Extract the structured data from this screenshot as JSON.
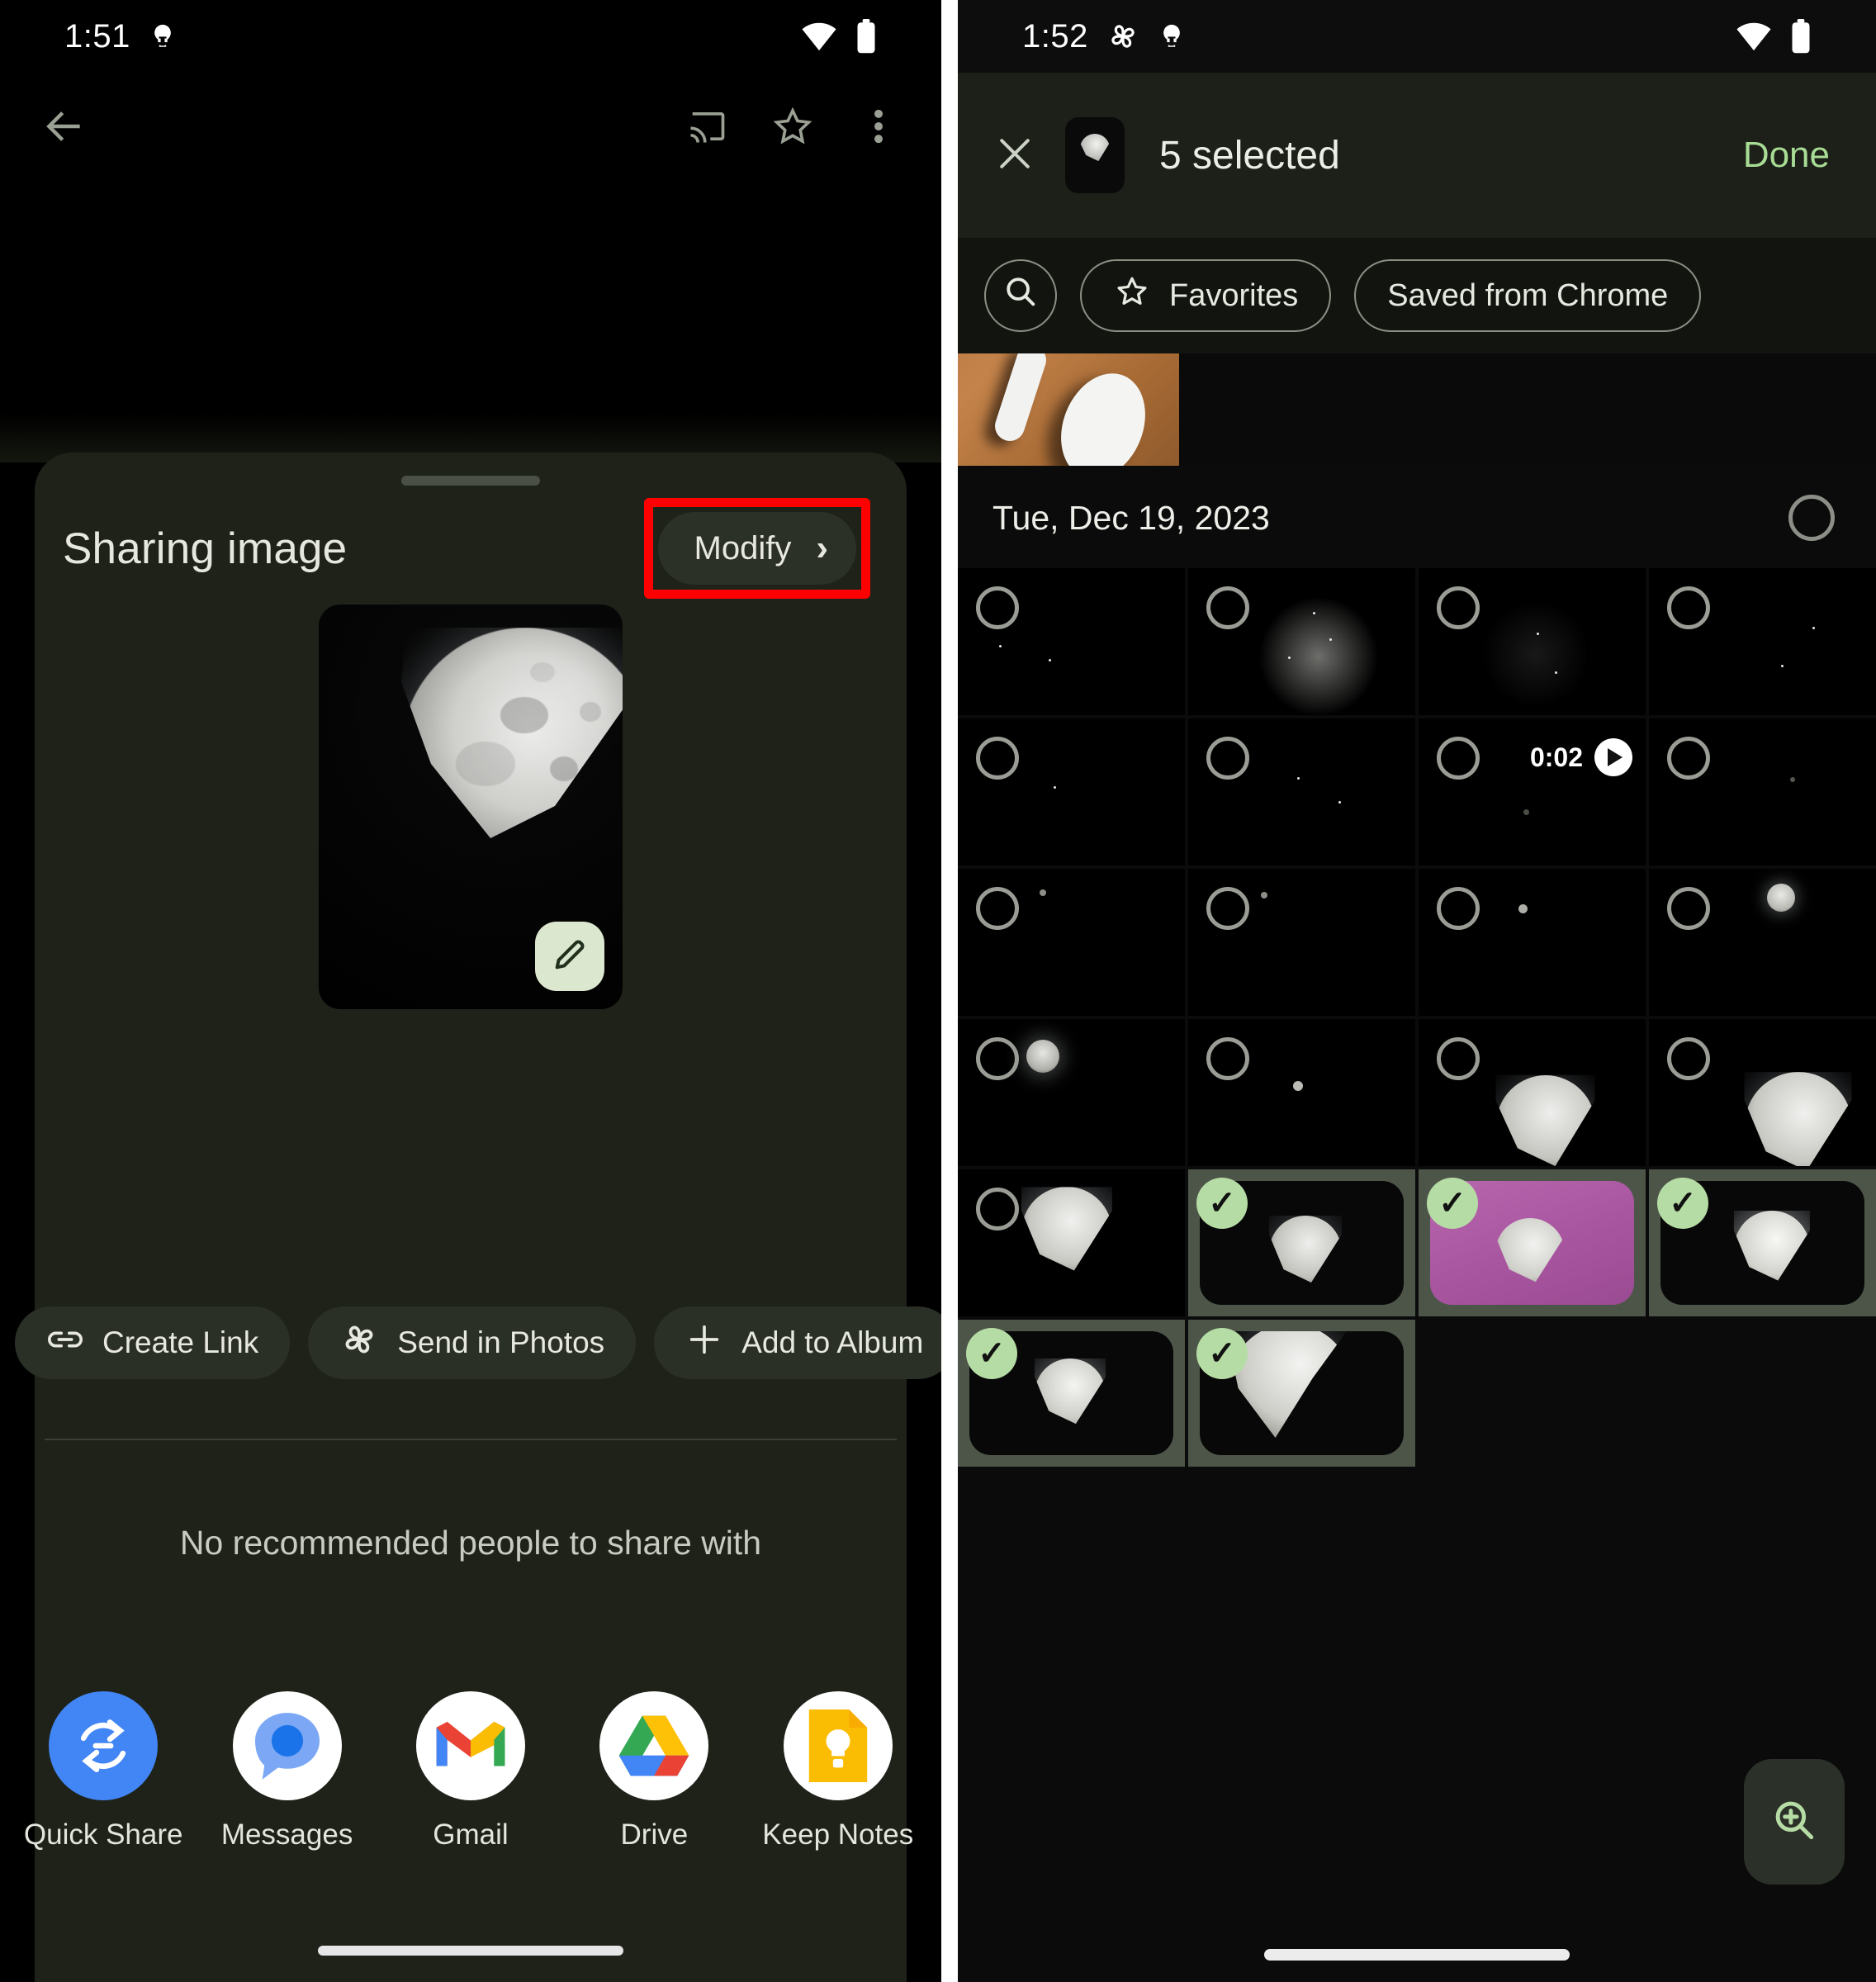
{
  "left_phone": {
    "status_bar": {
      "time": "1:51",
      "icons": [
        "bulb-icon",
        "wifi-icon",
        "battery-icon"
      ]
    },
    "app_bar": {
      "back": "back-arrow-icon",
      "cast": "cast-icon",
      "star": "star-icon",
      "overflow": "more-vert-icon"
    },
    "sheet": {
      "title": "Sharing image",
      "modify_label": "Modify",
      "modify_chevron": "›",
      "highlight_color": "#ff0000",
      "edit_fab": "pencil-icon",
      "chips": [
        {
          "label": "Create Link",
          "icon": "link-icon"
        },
        {
          "label": "Send in Photos",
          "icon": "photos-pinwheel-icon"
        },
        {
          "label": "Add to Album",
          "icon": "plus-icon"
        },
        {
          "label": "",
          "icon": "image-icon"
        }
      ],
      "no_recommendation": "No recommended people to share with",
      "apps": [
        {
          "label": "Quick Share",
          "icon": "quick-share-icon",
          "color": "#4285f4"
        },
        {
          "label": "Messages",
          "icon": "messages-icon",
          "color": "#1a73e8"
        },
        {
          "label": "Gmail",
          "icon": "gmail-icon",
          "color": "#ea4335"
        },
        {
          "label": "Drive",
          "icon": "drive-icon",
          "color": "#00ac47"
        },
        {
          "label": "Keep Notes",
          "icon": "keep-icon",
          "color": "#fbbc04"
        }
      ]
    }
  },
  "right_phone": {
    "status_bar": {
      "time": "1:52",
      "icons": [
        "photos-pinwheel-icon",
        "bulb-icon",
        "wifi-icon",
        "battery-icon"
      ]
    },
    "app_bar": {
      "close": "close-icon",
      "thumbnail": "moon-thumbnail",
      "title": "5 selected",
      "done_label": "Done",
      "done_color": "#a8dc95"
    },
    "filters": [
      {
        "label": "",
        "icon": "search-icon"
      },
      {
        "label": "Favorites",
        "icon": "star-outline-icon"
      },
      {
        "label": "Saved from Chrome",
        "icon": ""
      }
    ],
    "date_header": "Tue, Dec 19, 2023",
    "video_badge": {
      "duration": "0:02",
      "icon": "play-icon"
    },
    "zoom_fab": "zoom-in-icon",
    "selected_count": 5,
    "grid": [
      [
        {
          "type": "photo",
          "selected": false,
          "content": "night-sky"
        },
        {
          "type": "photo",
          "selected": false,
          "content": "blurred-moon-glow"
        },
        {
          "type": "photo",
          "selected": false,
          "content": "night-sky-faint"
        },
        {
          "type": "photo",
          "selected": false,
          "content": "night-sky"
        }
      ],
      [
        {
          "type": "photo",
          "selected": false,
          "content": "night-sky-stars"
        },
        {
          "type": "photo",
          "selected": false,
          "content": "night-sky-stars"
        },
        {
          "type": "video",
          "selected": false,
          "content": "night-sky-dot",
          "duration": "0:02"
        },
        {
          "type": "photo",
          "selected": false,
          "content": "night-sky-dot"
        }
      ],
      [
        {
          "type": "photo",
          "selected": false,
          "content": "tiny-dot"
        },
        {
          "type": "photo",
          "selected": false,
          "content": "tiny-dot"
        },
        {
          "type": "photo",
          "selected": false,
          "content": "tiny-dot"
        },
        {
          "type": "photo",
          "selected": false,
          "content": "small-moon"
        }
      ],
      [
        {
          "type": "photo",
          "selected": false,
          "content": "small-moon"
        },
        {
          "type": "photo",
          "selected": false,
          "content": "tiny-dot"
        },
        {
          "type": "photo",
          "selected": false,
          "content": "half-moon"
        },
        {
          "type": "photo",
          "selected": false,
          "content": "half-moon"
        }
      ],
      [
        {
          "type": "photo",
          "selected": false,
          "content": "half-moon"
        },
        {
          "type": "photo",
          "selected": true,
          "content": "half-moon"
        },
        {
          "type": "photo",
          "selected": true,
          "content": "half-moon-purple"
        },
        {
          "type": "photo",
          "selected": true,
          "content": "half-moon-bright"
        }
      ],
      [
        {
          "type": "photo",
          "selected": true,
          "content": "half-moon"
        },
        {
          "type": "photo",
          "selected": true,
          "content": "crescent-moon-large"
        },
        {
          "type": "empty",
          "selected": false,
          "content": ""
        },
        {
          "type": "empty",
          "selected": false,
          "content": ""
        }
      ]
    ]
  }
}
